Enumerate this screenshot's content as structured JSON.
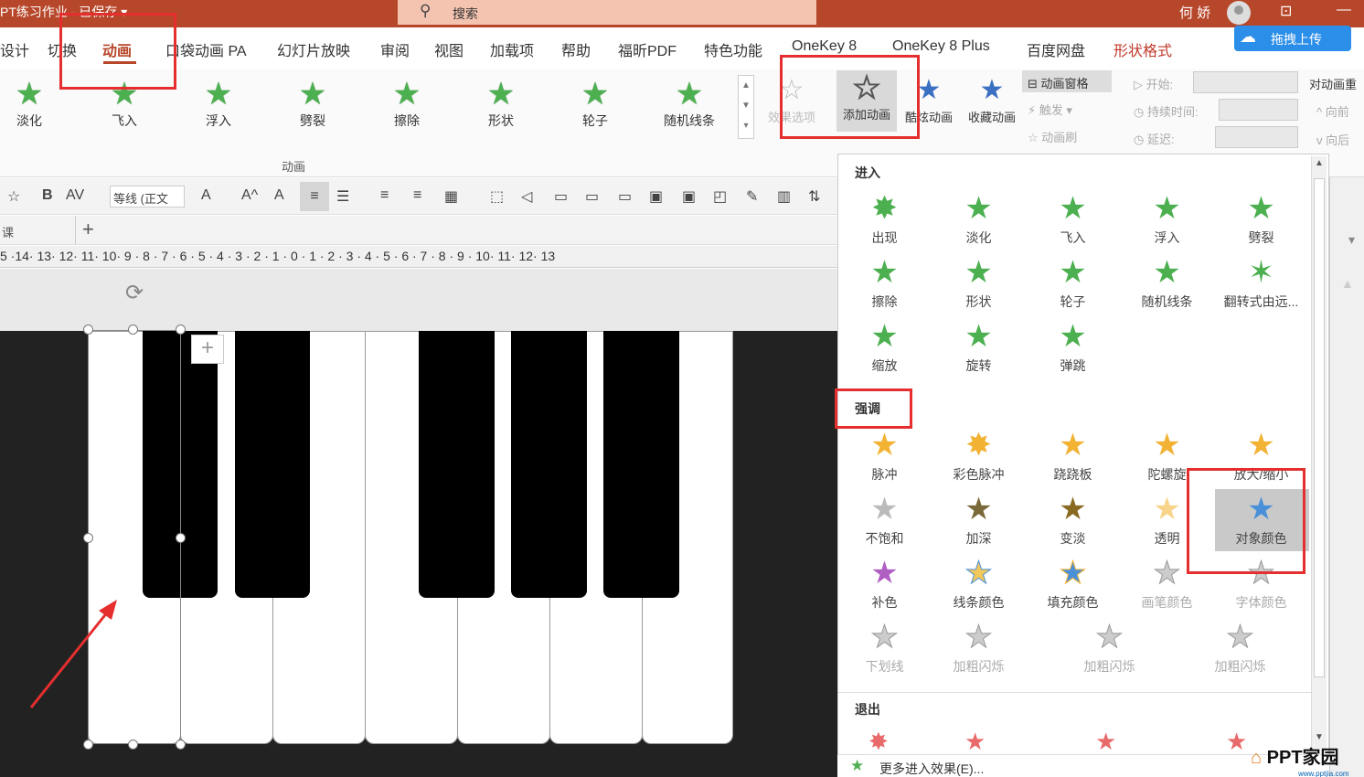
{
  "window": {
    "title": "PT练习作业 - 已保存 ▾",
    "user": "何 娇"
  },
  "search": {
    "placeholder": "搜索"
  },
  "tabs": [
    "设计",
    "切换",
    "动画",
    "口袋动画 PA",
    "幻灯片放映",
    "审阅",
    "视图",
    "加载项",
    "帮助",
    "福昕PDF",
    "特色功能",
    "OneKey 8",
    "OneKey 8 Plus",
    "百度网盘",
    "形状格式"
  ],
  "upload": "拖拽上传",
  "ribbon": {
    "gallery": [
      "淡化",
      "飞入",
      "浮入",
      "劈裂",
      "擦除",
      "形状",
      "轮子",
      "随机线条"
    ],
    "group_label": "动画",
    "effect_options": "效果选项",
    "add_animation": "添加动画",
    "cool_animation": "酷炫动画",
    "fav_animation": "收藏动画",
    "anim_pane": "动画窗格",
    "trigger": "触发",
    "anim_brush": "动画刷",
    "start": "开始:",
    "duration": "持续时间:",
    "delay": "延迟:",
    "reorder": "对动画重",
    "forward": "向前",
    "backward": "向后"
  },
  "format": {
    "font": "等线 (正文"
  },
  "doc": {
    "tab": "课"
  },
  "ruler": "5 ·14· 13· 12· 11· 10· 9 · 8 · 7 · 6 · 5 · 4 · 3 · 2 · 1 · 0 · 1 · 2 · 3 · 4 · 5 · 6 · 7 · 8 · 9 · 10· 11· 12· 13",
  "panel": {
    "enter_title": "进入",
    "enter": [
      "出现",
      "淡化",
      "飞入",
      "浮入",
      "劈裂",
      "擦除",
      "形状",
      "轮子",
      "随机线条",
      "翻转式由远...",
      "缩放",
      "旋转",
      "弹跳"
    ],
    "emph_title": "强调",
    "emph": [
      "脉冲",
      "彩色脉冲",
      "跷跷板",
      "陀螺旋",
      "放大/缩小",
      "不饱和",
      "加深",
      "变淡",
      "透明",
      "对象颜色",
      "补色",
      "线条颜色",
      "填充颜色",
      "画笔颜色",
      "字体颜色",
      "下划线",
      "加粗闪烁",
      "加粗闪烁",
      "加粗闪烁"
    ],
    "exit_title": "退出",
    "more": "更多进入效果(E)..."
  },
  "logo": {
    "name": "PPT家园",
    "url": "www.pptjia.com"
  }
}
